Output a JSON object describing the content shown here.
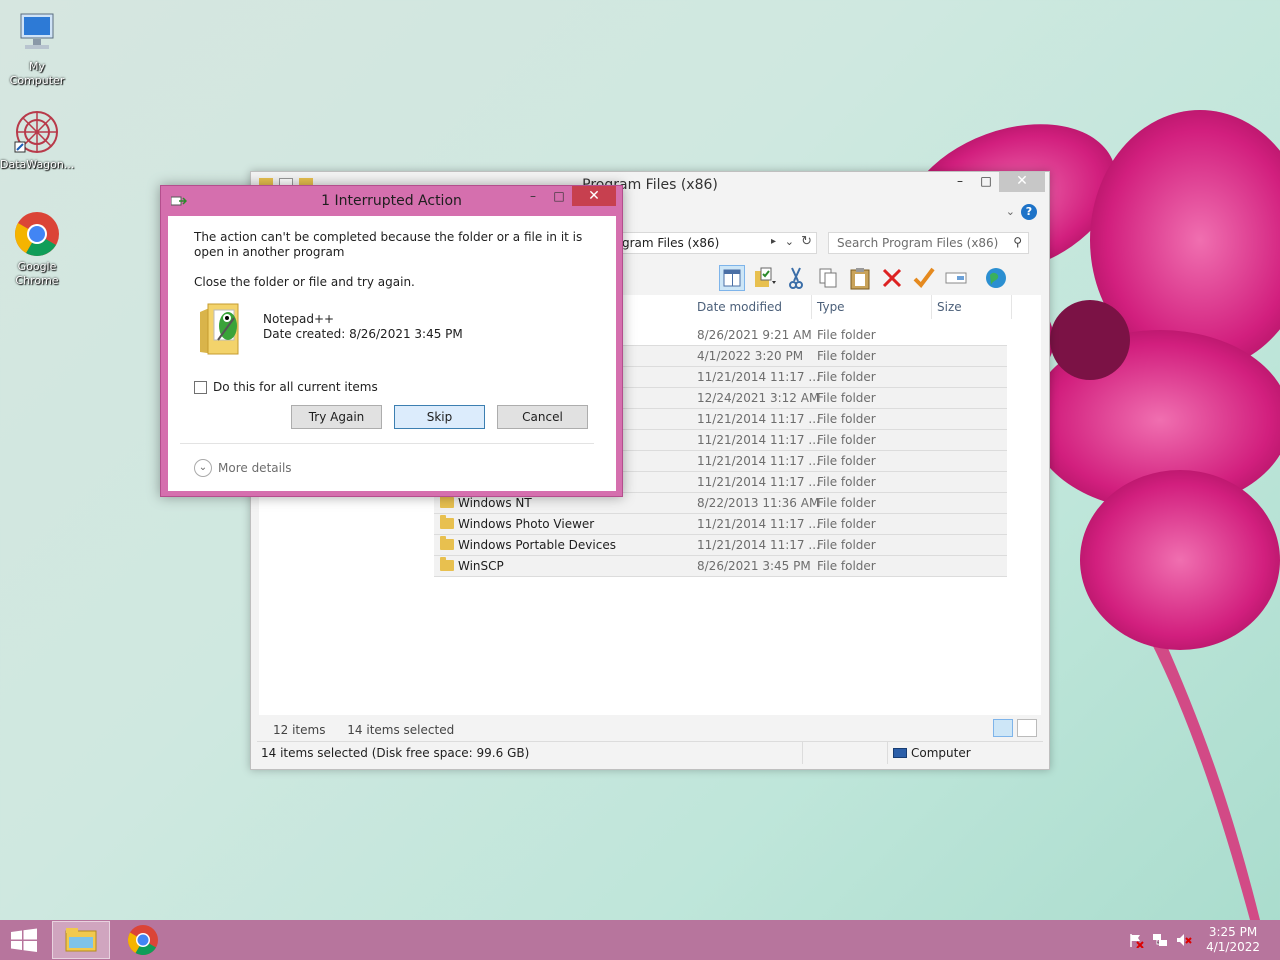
{
  "desktop": {
    "icons": [
      {
        "label": "My Computer"
      },
      {
        "label": "DataWagon..."
      },
      {
        "label": "Google Chrome"
      }
    ]
  },
  "explorer": {
    "title": "Program Files (x86)",
    "breadcrumb": "gram Files (x86)",
    "search_placeholder": "Search Program Files (x86)",
    "columns": {
      "date": "Date modified",
      "type": "Type",
      "size": "Size"
    },
    "rows": [
      {
        "name": "",
        "date": "8/26/2021 9:21 AM",
        "type": "File folder"
      },
      {
        "name": "",
        "date": "4/1/2022 3:20 PM",
        "type": "File folder"
      },
      {
        "name": "",
        "date": "11/21/2014 11:17 ...",
        "type": "File folder"
      },
      {
        "name": "",
        "date": "12/24/2021 3:12 AM",
        "type": "File folder"
      },
      {
        "name": "",
        "date": "11/21/2014 11:17 ...",
        "type": "File folder"
      },
      {
        "name": "",
        "date": "11/21/2014 11:17 ...",
        "type": "File folder"
      },
      {
        "name": "",
        "date": "11/21/2014 11:17 ...",
        "type": "File folder"
      },
      {
        "name": "",
        "date": "11/21/2014 11:17 ...",
        "type": "File folder"
      },
      {
        "name": "Windows NT",
        "date": "8/22/2013 11:36 AM",
        "type": "File folder"
      },
      {
        "name": "Windows Photo Viewer",
        "date": "11/21/2014 11:17 ...",
        "type": "File folder"
      },
      {
        "name": "Windows Portable Devices",
        "date": "11/21/2014 11:17 ...",
        "type": "File folder"
      },
      {
        "name": "WinSCP",
        "date": "8/26/2021 3:45 PM",
        "type": "File folder"
      }
    ],
    "item_count": "12 items",
    "selected_count": "14 items selected",
    "status_left": "14 items selected (Disk free space: 99.6 GB)",
    "status_right": "Computer"
  },
  "dialog": {
    "title": "1 Interrupted Action",
    "message": "The action can't be completed because the folder or a file in it is open in another program",
    "instruction": "Close the folder or file and try again.",
    "file_name": "Notepad++",
    "file_date": "Date created: 8/26/2021 3:45 PM",
    "checkbox_label": "Do this for all current items",
    "buttons": {
      "try_again": "Try Again",
      "skip": "Skip",
      "cancel": "Cancel"
    },
    "more_details": "More details"
  },
  "taskbar": {
    "time": "3:25 PM",
    "date": "4/1/2022"
  },
  "colors": {
    "dialog_frame": "#d56fae",
    "taskbar": "#b7759d",
    "close_red": "#c7404f"
  }
}
